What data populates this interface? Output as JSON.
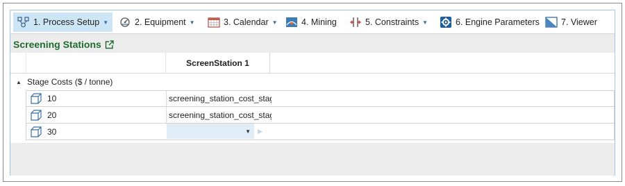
{
  "toolbar": {
    "tabs": [
      {
        "label": "1. Process Setup",
        "has_dropdown": true,
        "active": true,
        "icon": "process-setup-icon"
      },
      {
        "label": "2. Equipment",
        "has_dropdown": true,
        "active": false,
        "icon": "equipment-icon"
      },
      {
        "label": "3. Calendar",
        "has_dropdown": true,
        "active": false,
        "icon": "calendar-icon"
      },
      {
        "label": "4. Mining",
        "has_dropdown": false,
        "active": false,
        "icon": "mining-icon"
      },
      {
        "label": "5. Constraints",
        "has_dropdown": true,
        "active": false,
        "icon": "constraints-icon"
      },
      {
        "label": "6. Engine Parameters",
        "has_dropdown": false,
        "active": false,
        "icon": "engine-parameters-icon"
      },
      {
        "label": "7. Viewer",
        "has_dropdown": false,
        "active": false,
        "icon": "viewer-icon"
      }
    ],
    "dropdown_glyph": "▼"
  },
  "section": {
    "title": "Screening Stations",
    "title_color": "#1e6b2e"
  },
  "grid": {
    "column_header": "ScreenStation 1",
    "group": {
      "label": "Stage Costs ($ / tonne)",
      "expanded": true,
      "toggle_glyph": "▲"
    },
    "rows": [
      {
        "key": "10",
        "value": "screening_station_cost_stag"
      },
      {
        "key": "20",
        "value": "screening_station_cost_stag"
      },
      {
        "key": "30",
        "value": ""
      }
    ],
    "editor_dropdown_glyph": "▼",
    "next_glyph": "▶"
  },
  "colors": {
    "active_tab": "#cde6f5",
    "accent": "#2f6ea5",
    "editing_cell": "#e1edf6",
    "frame_border": "#9fc6e2"
  }
}
